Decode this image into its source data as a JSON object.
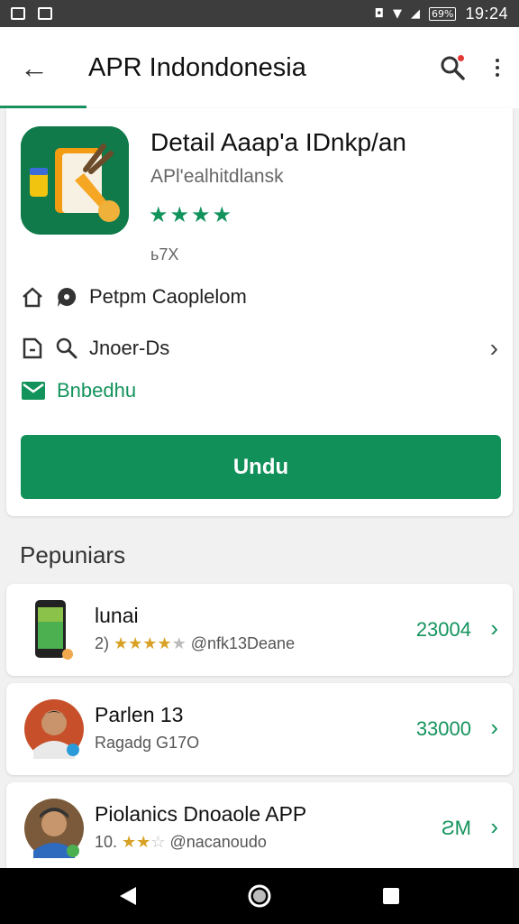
{
  "status_bar": {
    "time": "19:24",
    "battery": "69%"
  },
  "app_bar": {
    "title": "APR Indondonesia"
  },
  "app": {
    "name": "Detail Aaap'a IDnkp/an",
    "developer": "APl'ealhitdlansk",
    "stars": "★★★★",
    "size": "ь7X",
    "info_rows": [
      "Petpm Caoplelom",
      "Jnoer-Ds",
      "Bnbedhu"
    ],
    "install_label": "Undu"
  },
  "section": {
    "title": "Pepuniars"
  },
  "list": [
    {
      "title": "lunai",
      "rating_prefix": "2)",
      "stars": "★★★★",
      "star_empty": "★",
      "subtitle": "@nfk13Deane",
      "price": "23004"
    },
    {
      "title": "Parlen 13",
      "subtitle": "Ragadg G17O",
      "price": "33000"
    },
    {
      "title": "Piolanics Dnoaole APP",
      "rating_prefix": "10.",
      "stars": "★★",
      "star_empty": "☆",
      "subtitle": "@nacanoudo",
      "price": "ƧM"
    }
  ],
  "colors": {
    "accent": "#12905a",
    "status_bar": "#3d3d3d",
    "star_gold": "#d8a124"
  },
  "icons": [
    "back-arrow-icon",
    "search-icon",
    "more-vert-icon",
    "home-icon",
    "chat-icon",
    "file-icon",
    "search-small-icon",
    "chevron-right-icon",
    "mail-icon",
    "nav-back-icon",
    "nav-home-icon",
    "nav-recents-icon"
  ]
}
